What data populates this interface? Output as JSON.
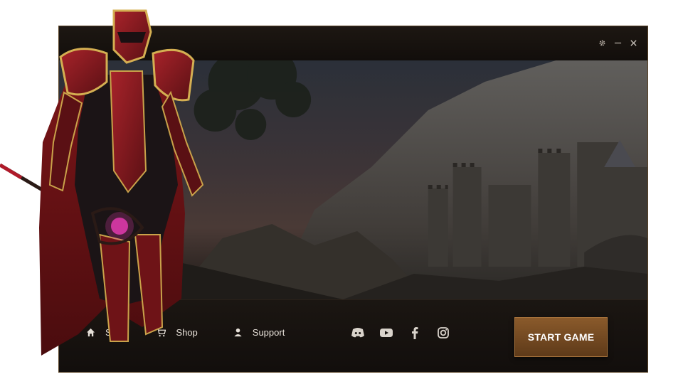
{
  "window_controls": {
    "settings_icon": "gear-icon",
    "minimize_icon": "minimize-icon",
    "close_icon": "close-icon"
  },
  "nav": {
    "items": [
      {
        "label": "Site",
        "icon": "home-icon"
      },
      {
        "label": "Shop",
        "icon": "cart-icon"
      },
      {
        "label": "Support",
        "icon": "user-icon"
      }
    ]
  },
  "socials": [
    "discord-icon",
    "youtube-icon",
    "facebook-icon",
    "instagram-icon"
  ],
  "start_button": {
    "label": "START GAME"
  },
  "colors": {
    "accent": "#8a5a2b",
    "frame_border": "#5a4326",
    "text": "#e7e1d9",
    "background": "#15110e"
  }
}
